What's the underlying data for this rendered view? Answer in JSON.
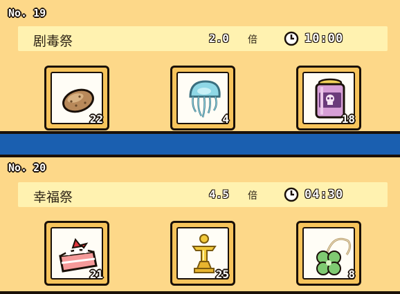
{
  "festivals": [
    {
      "no": "No. 19",
      "name": "剧毒祭",
      "multiplier": "2.0",
      "multiplier_unit": "倍",
      "timer": "10:00",
      "items": [
        {
          "icon": "potato-icon",
          "count": "22"
        },
        {
          "icon": "jellyfish-icon",
          "count": "4"
        },
        {
          "icon": "poison-jar-icon",
          "count": "18"
        }
      ]
    },
    {
      "no": "No. 20",
      "name": "幸福祭",
      "multiplier": "4.5",
      "multiplier_unit": "倍",
      "timer": "04:30",
      "items": [
        {
          "icon": "strawberry-cake-icon",
          "count": "21"
        },
        {
          "icon": "golden-trophy-icon",
          "count": "25"
        },
        {
          "icon": "four-leaf-clover-charm-icon",
          "count": "8"
        }
      ]
    }
  ],
  "colors": {
    "background_blue": "#1a5fb0",
    "panel": "#fdd889",
    "info_bar": "#fff2b0",
    "slot_frame": "#f7c45c",
    "outline": "#1a1008"
  }
}
